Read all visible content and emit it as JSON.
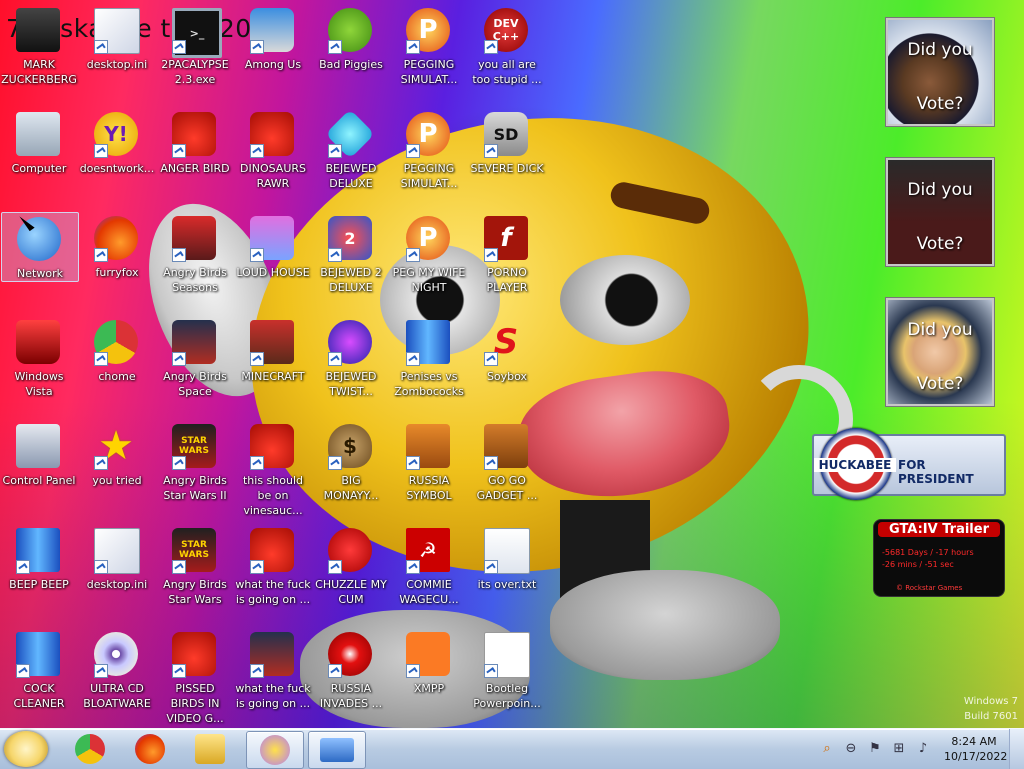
{
  "desktop": {
    "wallpaper_title": "7 osskanae tion 2012",
    "icons": [
      {
        "label": "MARK ZUCKERBERG",
        "glyph": "",
        "style": "g-person"
      },
      {
        "label": "desktop.ini",
        "glyph": "",
        "style": "g-file"
      },
      {
        "label": "2PACALYPSE 2.3.exe",
        "glyph": ">_",
        "style": "g-cmd"
      },
      {
        "label": "Among Us",
        "glyph": "",
        "style": "g-among"
      },
      {
        "label": "Bad Piggies",
        "glyph": "",
        "style": "g-pig"
      },
      {
        "label": "PEGGING SIMULAT...",
        "glyph": "P",
        "style": "g-peg"
      },
      {
        "label": "you all are too stupid ...",
        "glyph": "DEV C++",
        "style": "g-dev"
      },
      {
        "label": "Computer",
        "glyph": "",
        "style": "g-computer"
      },
      {
        "label": "doesntwork...",
        "glyph": "Y!",
        "style": "g-yahoo"
      },
      {
        "label": "ANGER BIRD",
        "glyph": "",
        "style": "g-bird"
      },
      {
        "label": "DINOSAURS RAWR",
        "glyph": "",
        "style": "g-bird"
      },
      {
        "label": "BEJEWED DELUXE",
        "glyph": "",
        "style": "g-gem"
      },
      {
        "label": "PEGGING SIMULAT...",
        "glyph": "P",
        "style": "g-peg"
      },
      {
        "label": "SEVERE DICK",
        "glyph": "SD",
        "style": "g-sd"
      },
      {
        "label": "Network",
        "glyph": "",
        "style": "g-network"
      },
      {
        "label": "furryfox",
        "glyph": "",
        "style": "g-firefox"
      },
      {
        "label": "Angry Birds Seasons",
        "glyph": "",
        "style": "g-seasons"
      },
      {
        "label": "LOUD HOUSE",
        "glyph": "",
        "style": "g-loud"
      },
      {
        "label": "BEJEWED 2 DELUXE",
        "glyph": "2",
        "style": "g-bej2"
      },
      {
        "label": "PEG MY WIFE NIGHT",
        "glyph": "P",
        "style": "g-peg"
      },
      {
        "label": "PORNO PLAYER",
        "glyph": "f",
        "style": "g-flash"
      },
      {
        "label": "Windows Vista",
        "glyph": "",
        "style": "g-vista"
      },
      {
        "label": "chome",
        "glyph": "",
        "style": "g-chrome"
      },
      {
        "label": "Angry Birds Space",
        "glyph": "",
        "style": "g-space"
      },
      {
        "label": "MINECRAFT",
        "glyph": "",
        "style": "g-minecraft"
      },
      {
        "label": "BEJEWED TWIST...",
        "glyph": "",
        "style": "g-twist"
      },
      {
        "label": "Penises vs Zombococks",
        "glyph": "",
        "style": "g-blue"
      },
      {
        "label": "Soybox",
        "glyph": "S",
        "style": "g-soybox"
      },
      {
        "label": "Control Panel",
        "glyph": "",
        "style": "g-cp"
      },
      {
        "label": "you tried",
        "glyph": "★",
        "style": "g-star"
      },
      {
        "label": "Angry Birds Star Wars II",
        "glyph": "STAR WARS",
        "style": "g-starwars"
      },
      {
        "label": "this should be on vinesauc...",
        "glyph": "",
        "style": "g-bird"
      },
      {
        "label": "BIG MONAYY...",
        "glyph": "$",
        "style": "g-money"
      },
      {
        "label": "RUSSIA SYMBOL",
        "glyph": "",
        "style": "g-russia"
      },
      {
        "label": "GO GO GADGET ...",
        "glyph": "",
        "style": "g-briefcase"
      },
      {
        "label": "BEEP BEEP",
        "glyph": "",
        "style": "g-blue"
      },
      {
        "label": "desktop.ini",
        "glyph": "",
        "style": "g-file"
      },
      {
        "label": "Angry Birds Star Wars",
        "glyph": "STAR WARS",
        "style": "g-starwars"
      },
      {
        "label": "what the fuck is going on ...",
        "glyph": "",
        "style": "g-bird"
      },
      {
        "label": "CHUZZLE MY CUM",
        "glyph": "",
        "style": "g-chuzzle"
      },
      {
        "label": "COMMIE WAGECU...",
        "glyph": "☭",
        "style": "g-commie"
      },
      {
        "label": "its over.txt",
        "glyph": "",
        "style": "g-txt"
      },
      {
        "label": "COCK CLEANER",
        "glyph": "",
        "style": "g-blue"
      },
      {
        "label": "ULTRA CD BLOATWARE",
        "glyph": "",
        "style": "g-cd"
      },
      {
        "label": "PISSED BIRDS IN VIDEO G...",
        "glyph": "",
        "style": "g-bird"
      },
      {
        "label": "what the fuck is going on ...",
        "glyph": "",
        "style": "g-space"
      },
      {
        "label": "RUSSIA INVADES ...",
        "glyph": "",
        "style": "g-rad"
      },
      {
        "label": "XMPP",
        "glyph": "",
        "style": "g-xampp"
      },
      {
        "label": "Bootleg Powerpoin...",
        "glyph": "",
        "style": "g-doc"
      }
    ]
  },
  "gadgets": {
    "vote1": {
      "line1": "Did you",
      "line2": "Vote?"
    },
    "vote2": {
      "line1": "Did you",
      "line2": "Vote?"
    },
    "vote3": {
      "line1": "Did you",
      "line2": "Vote?"
    },
    "huckabee": {
      "name": "HUCKABEE",
      "tagline": "FOR PRESIDENT"
    },
    "gta": {
      "title": "GTA:IV Trailer",
      "line1": "-5681 Days / -17 hours",
      "line2": "-26 mins / -51 sec",
      "footer": "© Rockstar Games"
    }
  },
  "watermark": {
    "line1": "Windows 7",
    "line2": "Build 7601"
  },
  "taskbar": {
    "pinned": [
      "start-orb",
      "chrome",
      "firefox",
      "explorer",
      "yahoo-messenger",
      "desktop-gadgets"
    ],
    "tray_icons": [
      "search-icon",
      "help-icon",
      "flag-icon",
      "network-icon",
      "volume-icon"
    ],
    "time": "8:24 AM",
    "date": "10/17/2022"
  },
  "colors": {
    "taskbar": "#b8cbe2",
    "selection": "#b4d2ff"
  }
}
